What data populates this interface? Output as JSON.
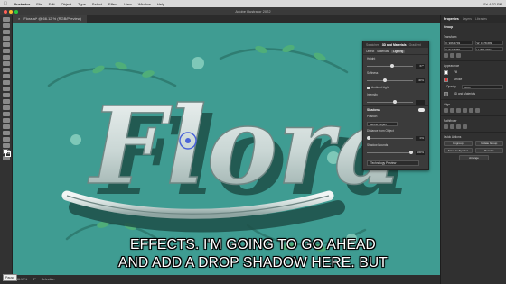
{
  "menubar": {
    "items": [
      "Illustrator",
      "File",
      "Edit",
      "Object",
      "Type",
      "Select",
      "Effect",
      "View",
      "Window",
      "Help"
    ],
    "status": "Fri 4:32 PM"
  },
  "window": {
    "title": "Adobe Illustrator 2022"
  },
  "document": {
    "tab_label": "Flora.ai* @ 66.12 % (RGB/Preview)",
    "close": "×"
  },
  "artwork": {
    "text": "Flora",
    "background_color": "#3f9c92"
  },
  "panel3d": {
    "tabs": [
      "Swatches",
      "3D and Materials",
      "Gradient"
    ],
    "subtabs": [
      "Object",
      "Materials",
      "Lighting"
    ],
    "rows": [
      {
        "label": "Height",
        "value": "67°",
        "level": 0.55
      },
      {
        "label": "Softness",
        "value": "40%",
        "level": 0.4
      },
      {
        "label": "Ambient Light",
        "value": ""
      },
      {
        "label": "Intensity",
        "value": "",
        "level": 0.6
      }
    ],
    "shadows_label": "Shadows",
    "position_label": "Position",
    "position_value": "Behind Object",
    "distance_label": "Distance from Object",
    "distance_value": "0%",
    "bounds_label": "Shadow Bounds",
    "bounds_value": "100%",
    "footer": "Technology Preview"
  },
  "properties": {
    "tabs": [
      "Properties",
      "Layers",
      "Libraries"
    ],
    "group_label": "Group",
    "transform_label": "Transform",
    "x": "X: 966.4793",
    "y": "Y: 510.8765",
    "w": "W: 1578.689",
    "h": "H: 819.3921",
    "appearance_label": "Appearance",
    "fill_label": "Fill",
    "stroke_label": "Stroke",
    "opacity_label": "Opacity",
    "opacity_value": "100%",
    "effect_label": "3D and Materials",
    "align_label": "Align",
    "pathfinder_label": "Pathfinder",
    "quick_actions_label": "Quick Actions",
    "buttons": [
      "Ungroup",
      "Isolate Group",
      "Save as Symbol",
      "Recolor",
      "Arrange"
    ]
  },
  "statusbar": {
    "zoom": "66.12%",
    "angle": "0°",
    "tool": "Selection",
    "tooltip": "Pause"
  },
  "subtitle": {
    "line1": "EFFECTS. I'M GOING TO GO AHEAD",
    "line2": "AND ADD A DROP SHADOW HERE. BUT"
  }
}
